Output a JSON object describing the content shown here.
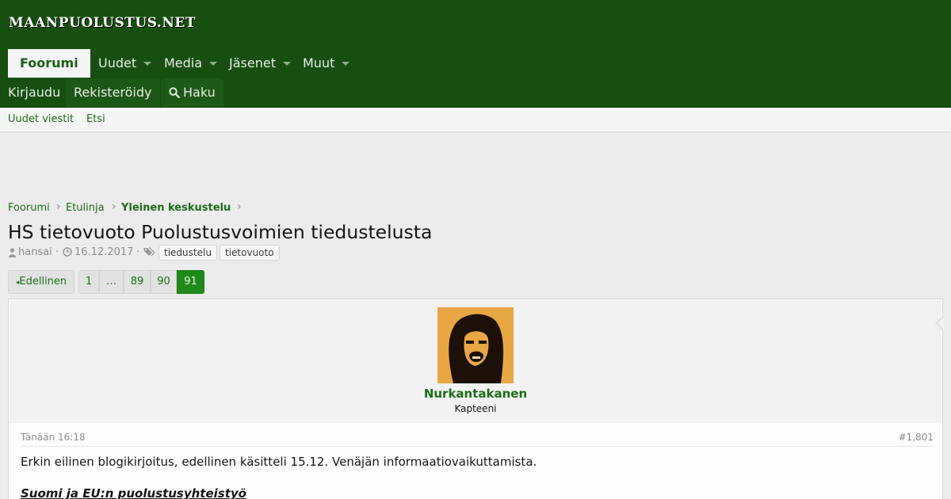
{
  "site": {
    "logo": "MAANPUOLUSTUS.NET"
  },
  "nav": {
    "tabs": [
      {
        "label": "Foorumi"
      },
      {
        "label": "Uudet"
      },
      {
        "label": "Media"
      },
      {
        "label": "Jäsenet"
      },
      {
        "label": "Muut"
      }
    ],
    "login": "Kirjaudu",
    "register": "Rekisteröidy",
    "search": "Haku"
  },
  "subnav": {
    "new_posts": "Uudet viestit",
    "find": "Etsi"
  },
  "breadcrumb": [
    "Foorumi",
    "Etulinja",
    "Yleinen keskustelu"
  ],
  "thread": {
    "title": "HS tietovuoto Puolustusvoimien tiedustelusta",
    "author": "hansai",
    "date": "16.12.2017",
    "tags": [
      "tiedustelu",
      "tietovuoto"
    ]
  },
  "pagination": {
    "prev": "Edellinen",
    "pages": [
      "1",
      "…",
      "89",
      "90",
      "91"
    ],
    "current": "91"
  },
  "post": {
    "username": "Nurkantakanen",
    "rank": "Kapteeni",
    "time": "Tänään 16:18",
    "number": "#1,801",
    "text": "Erkin eilinen blogikirjoitus, edellinen käsitteli 15.12. Venäjän informaatiovaikuttamista.",
    "heading": "Suomi ja EU:n puolustusyhteistyö"
  },
  "colors": {
    "header": "#174f11",
    "link": "#1b6d15",
    "current_page": "#1f8a1a"
  }
}
